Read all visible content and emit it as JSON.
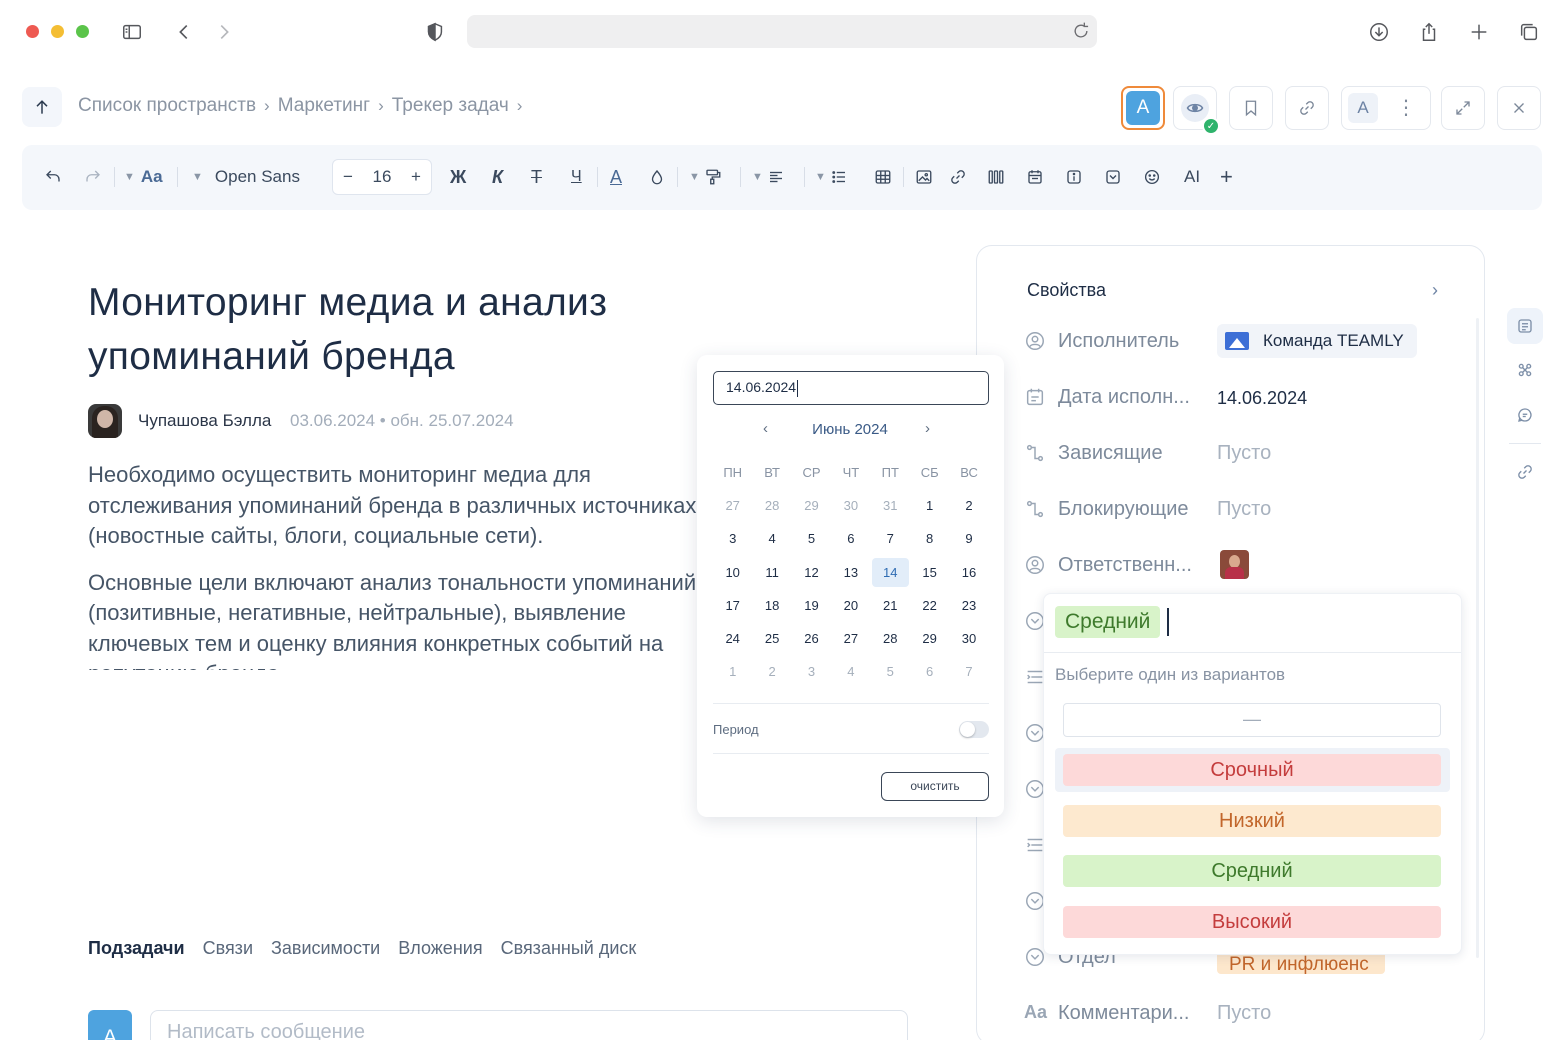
{
  "browser": {
    "url": ""
  },
  "breadcrumb": {
    "items": [
      "Список пространств",
      "Маркетинг",
      "Трекер задач"
    ],
    "separator": "›"
  },
  "topbar": {
    "user_initial": "A",
    "group_initial": "A"
  },
  "toolbar": {
    "text_style_label": "Aa",
    "font_name": "Open Sans",
    "font_size": "16",
    "minus": "−",
    "plus": "+",
    "bold": "Ж",
    "italic": "К",
    "strike": "Т",
    "underline": "Ч",
    "text_color": "A",
    "ai_label": "AI",
    "add": "+"
  },
  "document": {
    "title": "Мониторинг медиа и анализ упоминаний бренда",
    "author": "Чупашова Бэлла",
    "dates": "03.06.2024 • обн. 25.07.2024",
    "paragraphs": [
      "Необходимо осуществить мониторинг медиа для отслеживания упоминаний бренда в различных источниках (новостные сайты, блоги, социальные сети).",
      "Основные цели включают анализ тональности упоминаний (позитивные, негативные, нейтральные), выявление ключевых тем и оценку влияния конкретных событий на репутацию бренда."
    ]
  },
  "tabs": [
    "Подзадачи",
    "Связи",
    "Зависимости",
    "Вложения",
    "Связанный диск"
  ],
  "message": {
    "avatar_initial": "A",
    "placeholder": "Написать сообщение"
  },
  "properties": {
    "title": "Свойства",
    "assignee_label": "Исполнитель",
    "assignee_value": "Команда TEAMLY",
    "due_label": "Дата исполн...",
    "due_value": "14.06.2024",
    "dependent_label": "Зависящие",
    "dependent_value": "Пусто",
    "blocking_label": "Блокирующие",
    "blocking_value": "Пусто",
    "responsible_label": "Ответственн...",
    "department_label": "Отдел",
    "department_value": "PR и инфлюенс",
    "comment_label": "Комментари...",
    "comment_value": "Пусто"
  },
  "priority_dropdown": {
    "selected": "Средний",
    "hint": "Выберите один из вариантов",
    "none_option": "—",
    "options": [
      "Срочный",
      "Низкий",
      "Средний",
      "Высокий"
    ],
    "colors": {
      "urgent_bg": "#fdd9d9",
      "low_bg": "#fde9cf",
      "medium_bg": "#d8f3c9",
      "high_bg": "#fdd9d9"
    }
  },
  "datepicker": {
    "value": "14.06.2024",
    "month_label": "Июнь 2024",
    "prev": "‹",
    "next": "›",
    "weekdays": [
      "ПН",
      "ВТ",
      "СР",
      "ЧТ",
      "ПТ",
      "СБ",
      "ВС"
    ],
    "days": [
      [
        "27",
        "28",
        "29",
        "30",
        "31",
        "1",
        "2"
      ],
      [
        "3",
        "4",
        "5",
        "6",
        "7",
        "8",
        "9"
      ],
      [
        "10",
        "11",
        "12",
        "13",
        "14",
        "15",
        "16"
      ],
      [
        "17",
        "18",
        "19",
        "20",
        "21",
        "22",
        "23"
      ],
      [
        "24",
        "25",
        "26",
        "27",
        "28",
        "29",
        "30"
      ],
      [
        "1",
        "2",
        "3",
        "4",
        "5",
        "6",
        "7"
      ]
    ],
    "selected_day": "14",
    "period_label": "Период",
    "clear_label": "очистить"
  },
  "colors": {
    "accent": "#4ea3df",
    "avatar_border": "#ef8a3a",
    "online": "#2fb36c"
  }
}
